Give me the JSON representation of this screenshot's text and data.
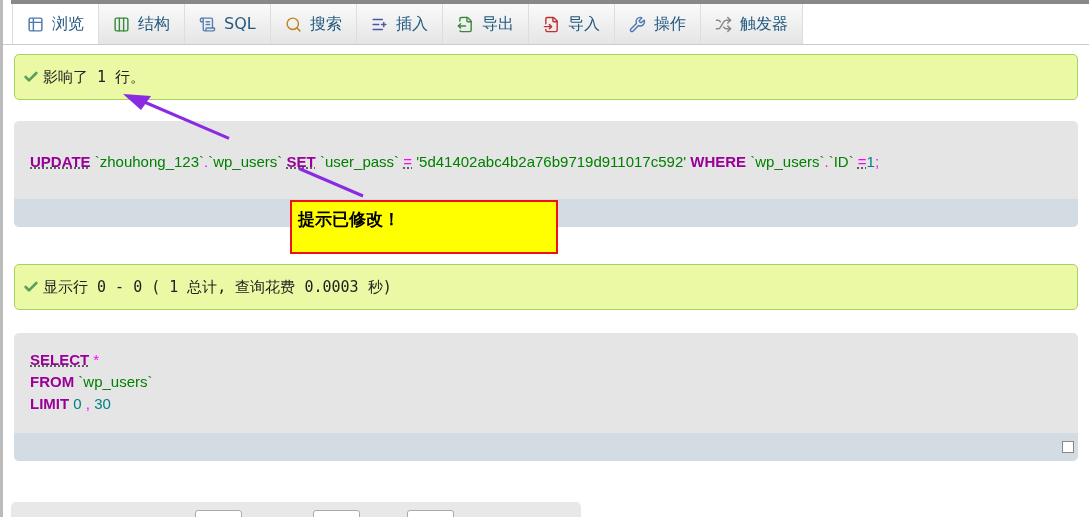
{
  "tabs": [
    {
      "label": "浏览",
      "selected": true
    },
    {
      "label": "结构",
      "selected": false
    },
    {
      "label": "SQL",
      "selected": false
    },
    {
      "label": "搜索",
      "selected": false
    },
    {
      "label": "插入",
      "selected": false
    },
    {
      "label": "导出",
      "selected": false
    },
    {
      "label": "导入",
      "selected": false
    },
    {
      "label": "操作",
      "selected": false
    },
    {
      "label": "触发器",
      "selected": false
    }
  ],
  "messages": [
    {
      "text": "影响了 1 行。",
      "query": {
        "lines": [
          [
            [
              {
                "kind": "keyword_link",
                "text": "UPDATE"
              }
            ],
            [
              {
                "kind": "identifier",
                "text": "`zhouhong_123`"
              },
              {
                "kind": "punct",
                "text": "."
              },
              {
                "kind": "identifier",
                "text": "`wp_users`"
              }
            ],
            [
              {
                "kind": "keyword_link",
                "text": "SET"
              }
            ],
            [
              {
                "kind": "identifier",
                "text": "`user_pass`"
              }
            ],
            [
              {
                "kind": "operator_link",
                "text": "="
              }
            ],
            [
              {
                "kind": "string",
                "text": "'5d41402abc4b2a76b9719d911017c592'"
              }
            ],
            [
              {
                "kind": "keyword",
                "text": "WHERE"
              }
            ],
            [
              {
                "kind": "identifier",
                "text": "`wp_users`"
              },
              {
                "kind": "punct",
                "text": "."
              },
              {
                "kind": "identifier",
                "text": "`ID`"
              }
            ],
            [
              {
                "kind": "operator_link",
                "text": "="
              },
              {
                "kind": "number",
                "text": "1"
              },
              {
                "kind": "punct",
                "text": ";"
              }
            ]
          ]
        ]
      }
    },
    {
      "text": "显示行 0 - 0 ( 1 总计, 查询花费 0.0003 秒)",
      "query": {
        "lines": [
          [
            [
              {
                "kind": "keyword_link",
                "text": "SELECT"
              }
            ],
            [
              {
                "kind": "punct",
                "text": "*"
              }
            ]
          ],
          [
            [
              {
                "kind": "keyword",
                "text": "FROM"
              }
            ],
            [
              {
                "kind": "identifier",
                "text": "`wp_users`"
              }
            ]
          ],
          [
            [
              {
                "kind": "keyword",
                "text": "LIMIT"
              }
            ],
            [
              {
                "kind": "number",
                "text": "0"
              }
            ],
            [
              {
                "kind": "punct",
                "text": ","
              }
            ],
            [
              {
                "kind": "number",
                "text": "30"
              }
            ]
          ]
        ],
        "checkbox": {
          "checked": false
        }
      }
    }
  ],
  "annotation": {
    "text": "提示已修改！"
  }
}
